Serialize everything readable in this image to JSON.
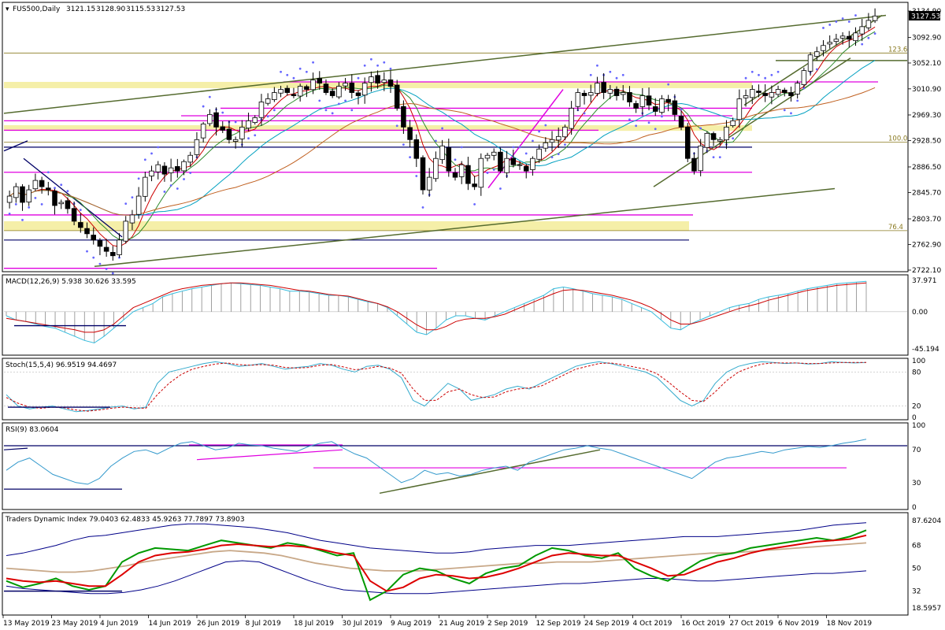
{
  "chart_data": {
    "type": "candlestick",
    "symbol": "FUS500,Daily",
    "ohlc": {
      "open": "3121.15",
      "high": "3128.90",
      "low": "3115.53",
      "close": "3127.53"
    },
    "colors": {
      "up": "#ffffff",
      "down": "#000000",
      "magenta": "#e000e0",
      "olive": "#556b2f",
      "navy": "#000066",
      "band": "#f5efa8",
      "fib": "#8a7a20",
      "ma_red": "#cc0000",
      "ma_green": "#2e8b2e",
      "ma_teal": "#00a0c0",
      "ma_brown": "#c06020",
      "psar": "#6666ff",
      "macd_line": "#33bbdd",
      "macd_signal": "#cc0000",
      "stoch_main": "#33aacc",
      "stoch_signal": "#cc0000",
      "rsi": "#3399cc",
      "tdi_band": "#000088",
      "tdi_mid": "#c8a888",
      "tdi_green": "#009900",
      "tdi_red": "#dd0000"
    },
    "price_ticks": [
      "3134.90",
      "3092.90",
      "3052.10",
      "3010.90",
      "2969.30",
      "2928.50",
      "2886.50",
      "2845.70",
      "2803.70",
      "2762.90",
      "2722.10"
    ],
    "price_range": [
      2722.1,
      3134.9
    ],
    "current_price": "3127.53",
    "fib_levels": [
      {
        "label": "123.6",
        "value": 3068
      },
      {
        "label": "100.0",
        "value": 2926
      },
      {
        "label": "76.4",
        "value": 2785
      }
    ],
    "closes": [
      2840,
      2855,
      2830,
      2850,
      2865,
      2855,
      2850,
      2825,
      2830,
      2820,
      2800,
      2790,
      2780,
      2770,
      2760,
      2752,
      2745,
      2770,
      2800,
      2810,
      2840,
      2870,
      2880,
      2890,
      2875,
      2885,
      2880,
      2895,
      2905,
      2930,
      2955,
      2970,
      2950,
      2945,
      2930,
      2930,
      2950,
      2960,
      2965,
      2990,
      2995,
      3005,
      3010,
      3005,
      3000,
      3015,
      3010,
      3025,
      3020,
      3005,
      3000,
      3015,
      3020,
      3005,
      3000,
      3020,
      3030,
      3020,
      3025,
      3015,
      2980,
      2950,
      2930,
      2900,
      2850,
      2870,
      2900,
      2920,
      2880,
      2870,
      2890,
      2860,
      2855,
      2900,
      2905,
      2910,
      2880,
      2900,
      2890,
      2890,
      2880,
      2900,
      2915,
      2925,
      2930,
      2935,
      2950,
      2980,
      3005,
      3000,
      3005,
      3020,
      3005,
      3010,
      3000,
      3005,
      2990,
      2980,
      3000,
      2985,
      2975,
      2995,
      2990,
      2970,
      2950,
      2900,
      2880,
      2920,
      2940,
      2930,
      2930,
      2950,
      2960,
      2995,
      3000,
      3010,
      3005,
      3000,
      3005,
      3010,
      3005,
      3000,
      3020,
      3040,
      3065,
      3070,
      3080,
      3085,
      3090,
      3095,
      3090,
      3100,
      3110,
      3120,
      3127
    ],
    "macd_ticks": [
      "37.971",
      "0.00",
      "-45.194"
    ],
    "macd_label": "MACD(12,26,9) 5.938 30.626 33.595",
    "macd_range": [
      -50,
      42
    ],
    "macd_main": [
      -5,
      -10,
      -12,
      -15,
      -18,
      -20,
      -25,
      -30,
      -35,
      -38,
      -30,
      -20,
      -10,
      0,
      5,
      10,
      18,
      22,
      25,
      28,
      30,
      32,
      34,
      35,
      34,
      33,
      32,
      30,
      28,
      25,
      25,
      24,
      22,
      20,
      20,
      18,
      15,
      12,
      10,
      5,
      -5,
      -15,
      -25,
      -28,
      -20,
      -10,
      -5,
      -5,
      -8,
      -10,
      -5,
      0,
      5,
      10,
      15,
      20,
      28,
      30,
      28,
      25,
      22,
      20,
      18,
      15,
      10,
      5,
      0,
      -10,
      -20,
      -22,
      -15,
      -10,
      -5,
      0,
      5,
      8,
      10,
      15,
      18,
      20,
      22,
      25,
      28,
      30,
      32,
      34,
      35,
      36,
      37
    ],
    "macd_signal": [
      -8,
      -10,
      -12,
      -14,
      -16,
      -18,
      -20,
      -22,
      -25,
      -25,
      -22,
      -15,
      -5,
      5,
      10,
      15,
      20,
      25,
      28,
      30,
      32,
      33,
      34,
      35,
      35,
      34,
      33,
      32,
      30,
      28,
      26,
      25,
      23,
      21,
      20,
      19,
      16,
      13,
      10,
      6,
      0,
      -8,
      -16,
      -22,
      -22,
      -18,
      -12,
      -9,
      -8,
      -8,
      -6,
      -3,
      2,
      7,
      12,
      17,
      22,
      26,
      27,
      26,
      24,
      22,
      20,
      17,
      14,
      10,
      5,
      -2,
      -10,
      -15,
      -15,
      -12,
      -8,
      -4,
      0,
      4,
      7,
      10,
      14,
      17,
      20,
      23,
      26,
      28,
      30,
      32,
      33,
      34,
      35
    ],
    "stoch_ticks": [
      "100",
      "80",
      "20",
      "0"
    ],
    "stoch_label": "Stoch(15,5,4) 96.9519 94.4697",
    "stoch_main": [
      40,
      20,
      15,
      18,
      20,
      15,
      10,
      12,
      15,
      18,
      20,
      15,
      18,
      60,
      80,
      85,
      90,
      95,
      98,
      95,
      90,
      92,
      95,
      90,
      85,
      88,
      90,
      95,
      92,
      85,
      80,
      90,
      92,
      85,
      70,
      30,
      20,
      40,
      60,
      50,
      30,
      35,
      40,
      50,
      55,
      50,
      60,
      70,
      80,
      90,
      95,
      98,
      95,
      90,
      85,
      80,
      70,
      50,
      30,
      20,
      30,
      60,
      80,
      90,
      95,
      98,
      97,
      95,
      96,
      94,
      95,
      98,
      97,
      96,
      97
    ],
    "stoch_signal": [
      35,
      25,
      18,
      16,
      18,
      17,
      13,
      11,
      13,
      16,
      18,
      17,
      16,
      40,
      60,
      75,
      85,
      90,
      94,
      96,
      93,
      92,
      93,
      92,
      88,
      87,
      88,
      92,
      93,
      89,
      84,
      86,
      90,
      87,
      78,
      50,
      30,
      30,
      45,
      50,
      40,
      35,
      36,
      45,
      50,
      52,
      55,
      65,
      75,
      85,
      90,
      95,
      96,
      93,
      89,
      85,
      77,
      62,
      45,
      30,
      28,
      45,
      65,
      80,
      88,
      94,
      96,
      96,
      96,
      95,
      95,
      96,
      97,
      97,
      97
    ],
    "rsi_ticks": [
      "100",
      "70",
      "30",
      "0"
    ],
    "rsi_label": "RSI(9) 83.0604",
    "rsi_values": [
      45,
      55,
      60,
      50,
      40,
      35,
      30,
      28,
      35,
      50,
      60,
      68,
      70,
      65,
      72,
      78,
      80,
      75,
      70,
      72,
      78,
      76,
      75,
      72,
      70,
      68,
      74,
      78,
      80,
      72,
      65,
      60,
      50,
      40,
      30,
      35,
      45,
      40,
      42,
      38,
      40,
      45,
      48,
      50,
      45,
      55,
      60,
      65,
      70,
      72,
      75,
      72,
      70,
      65,
      60,
      55,
      50,
      45,
      40,
      35,
      45,
      55,
      60,
      62,
      65,
      68,
      66,
      70,
      72,
      74,
      73,
      75,
      78,
      80,
      83
    ],
    "tdi_ticks": [
      "87.6204",
      "68",
      "50",
      "32",
      "18.5957"
    ],
    "tdi_label": "Traders Dynamic Index 79.0403 62.4833 45.9263 77.7897 73.8903",
    "tdi_range": [
      15,
      92
    ],
    "tdi_upper": [
      60,
      62,
      65,
      68,
      72,
      75,
      76,
      78,
      80,
      82,
      84,
      85,
      85,
      84,
      83,
      82,
      80,
      78,
      75,
      72,
      70,
      68,
      66,
      65,
      64,
      63,
      62,
      62,
      63,
      65,
      66,
      67,
      68,
      68,
      68,
      69,
      70,
      71,
      72,
      73,
      74,
      75,
      75,
      75,
      76,
      77,
      78,
      79,
      80,
      82,
      84,
      85,
      86
    ],
    "tdi_lower": [
      36,
      34,
      33,
      32,
      31,
      30,
      30,
      31,
      33,
      36,
      40,
      45,
      50,
      55,
      56,
      55,
      50,
      45,
      40,
      36,
      33,
      32,
      31,
      30,
      30,
      30,
      31,
      32,
      33,
      34,
      35,
      36,
      37,
      38,
      38,
      39,
      40,
      41,
      42,
      42,
      41,
      40,
      40,
      41,
      42,
      43,
      44,
      45,
      46,
      46,
      47,
      48
    ],
    "tdi_mid": [
      50,
      49,
      48,
      47,
      47,
      48,
      50,
      52,
      55,
      57,
      59,
      61,
      63,
      64,
      63,
      62,
      60,
      57,
      54,
      52,
      50,
      49,
      48,
      48,
      48,
      49,
      50,
      51,
      52,
      53,
      54,
      54,
      55,
      55,
      55,
      56,
      57,
      58,
      59,
      60,
      61,
      62,
      62,
      63,
      64,
      65,
      66,
      67,
      68,
      69,
      70
    ],
    "tdi_green": [
      40,
      35,
      38,
      42,
      36,
      33,
      36,
      55,
      62,
      66,
      65,
      64,
      68,
      72,
      70,
      68,
      66,
      70,
      68,
      64,
      60,
      62,
      25,
      32,
      45,
      50,
      48,
      42,
      38,
      46,
      50,
      52,
      60,
      66,
      64,
      60,
      58,
      62,
      50,
      44,
      40,
      48,
      56,
      60,
      62,
      66,
      68,
      70,
      72,
      74,
      72,
      75,
      80
    ],
    "tdi_red": [
      42,
      40,
      39,
      40,
      38,
      36,
      36,
      45,
      55,
      60,
      62,
      63,
      65,
      68,
      69,
      68,
      67,
      68,
      67,
      65,
      62,
      60,
      40,
      32,
      35,
      42,
      45,
      44,
      42,
      43,
      46,
      50,
      55,
      60,
      62,
      61,
      60,
      60,
      55,
      50,
      44,
      45,
      50,
      55,
      58,
      62,
      65,
      67,
      69,
      71,
      72,
      73,
      76
    ],
    "date_labels": [
      "13 May 2019",
      "23 May 2019",
      "4 Jun 2019",
      "14 Jun 2019",
      "26 Jun 2019",
      "8 Jul 2019",
      "18 Jul 2019",
      "30 Jul 2019",
      "9 Aug 2019",
      "21 Aug 2019",
      "2 Sep 2019",
      "12 Sep 2019",
      "24 Sep 2019",
      "4 Oct 2019",
      "16 Oct 2019",
      "27 Oct 2019",
      "6 Nov 2019",
      "18 Nov 2019"
    ]
  }
}
